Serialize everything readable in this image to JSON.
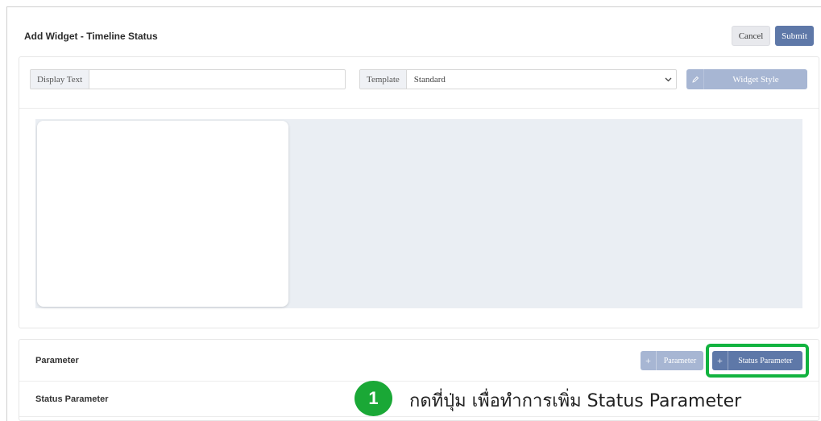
{
  "header": {
    "title": "Add Widget - Timeline Status",
    "cancel_label": "Cancel",
    "submit_label": "Submit"
  },
  "settings": {
    "display_text_label": "Display Text",
    "display_text_value": "",
    "template_label": "Template",
    "template_value": "Standard",
    "widget_style_label": "Widget Style",
    "widget_style_icon": "pencil-icon"
  },
  "parameters": {
    "parameter_label": "Parameter",
    "status_parameter_label": "Status Parameter",
    "add_parameter_label": "Parameter",
    "add_status_parameter_label": "Status Parameter"
  },
  "annotation": {
    "step_number": "1",
    "instruction": "กดที่ปุ่ม เพื่อทำการเพิ่ม Status Parameter",
    "highlight_color": "#12b33f"
  },
  "colors": {
    "primary": "#5e78a8",
    "primary_light": "#a7b6d3",
    "preview_bg": "#eaeef3"
  }
}
